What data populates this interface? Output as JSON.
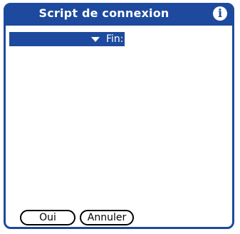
{
  "window": {
    "title": "Script de connexion",
    "info_icon": "info-icon",
    "info_glyph": "i"
  },
  "script_row": {
    "picker_icon": "triangle-down-icon",
    "label": "Fin:"
  },
  "buttons": {
    "ok_label": "Oui",
    "cancel_label": "Annuler"
  },
  "colors": {
    "accent": "#1d4a9e",
    "background": "#ffffff",
    "button_border": "#000000"
  }
}
